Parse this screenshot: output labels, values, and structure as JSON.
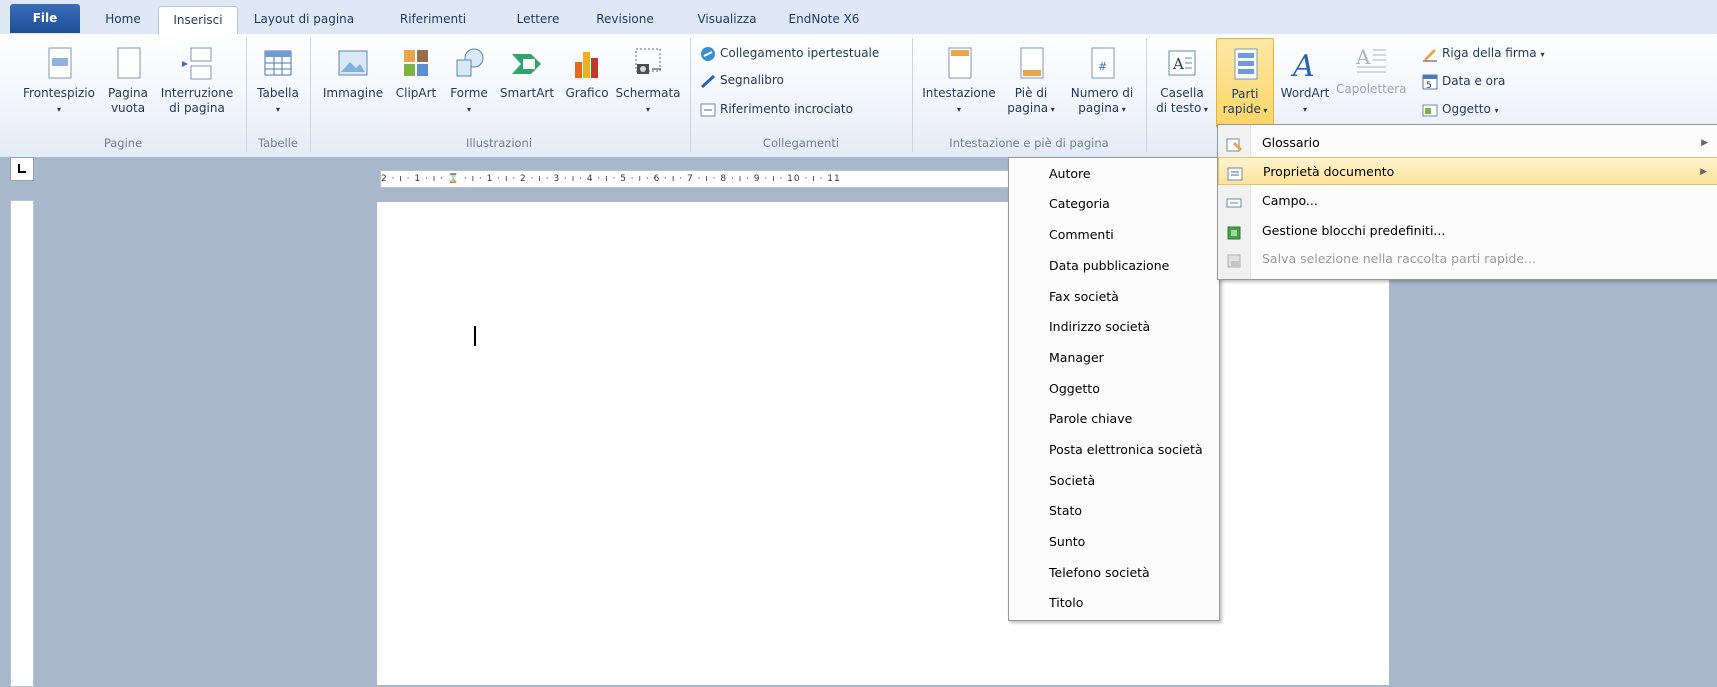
{
  "tabs": [
    "File",
    "Home",
    "Inserisci",
    "Layout di pagina",
    "Riferimenti",
    "Lettere",
    "Revisione",
    "Visualizza",
    "EndNote X6"
  ],
  "ribbon": {
    "pagine": {
      "label": "Pagine",
      "frontespizio": "Frontespizio",
      "pagina_vuota_1": "Pagina",
      "pagina_vuota_2": "vuota",
      "interruzione_1": "Interruzione",
      "interruzione_2": "di pagina"
    },
    "tabelle": {
      "label": "Tabelle",
      "tabella": "Tabella"
    },
    "illustrazioni": {
      "label": "Illustrazioni",
      "immagine": "Immagine",
      "clipart": "ClipArt",
      "forme": "Forme",
      "smartart": "SmartArt",
      "grafico": "Grafico",
      "schermata": "Schermata"
    },
    "collegamenti": {
      "label": "Collegamenti",
      "collegamento": "Collegamento ipertestuale",
      "segnalibro": "Segnalibro",
      "riferimento": "Riferimento incrociato"
    },
    "intestazione": {
      "label": "Intestazione e piè di pagina",
      "intestazione": "Intestazione",
      "pie_1": "Piè di",
      "pie_2": "pagina",
      "numero_1": "Numero di",
      "numero_2": "pagina"
    },
    "testo": {
      "casella_1": "Casella",
      "casella_2": "di testo",
      "parti_1": "Parti",
      "parti_2": "rapide",
      "wordart": "WordArt",
      "capolettera": "Capolettera",
      "riga_firma": "Riga della firma",
      "data_ora": "Data e ora",
      "oggetto": "Oggetto"
    }
  },
  "ruler_text": "2 · ı · 1 · ı · ⌛ · ı · 1 · ı · 2 · ı · 3 · ı · 4 · ı · 5 · ı · 6 · ı · 7 · ı · 8 · ı · 9 · ı · 10 · ı · 11",
  "parti_rapide_menu": [
    {
      "label": "Glossario",
      "submenu": true,
      "disabled": false
    },
    {
      "label": "Proprietà documento",
      "submenu": true,
      "disabled": false,
      "highlighted": true
    },
    {
      "label": "Campo...",
      "submenu": false,
      "disabled": false
    },
    {
      "label": "Gestione blocchi predefiniti...",
      "submenu": false,
      "disabled": false
    },
    {
      "label": "Salva selezione nella raccolta parti rapide...",
      "submenu": false,
      "disabled": true
    }
  ],
  "proprieta_submenu": [
    "Autore",
    "Categoria",
    "Commenti",
    "Data pubblicazione",
    "Fax società",
    "Indirizzo società",
    "Manager",
    "Oggetto",
    "Parole chiave",
    "Posta elettronica società",
    "Società",
    "Stato",
    "Sunto",
    "Telefono società",
    "Titolo"
  ]
}
